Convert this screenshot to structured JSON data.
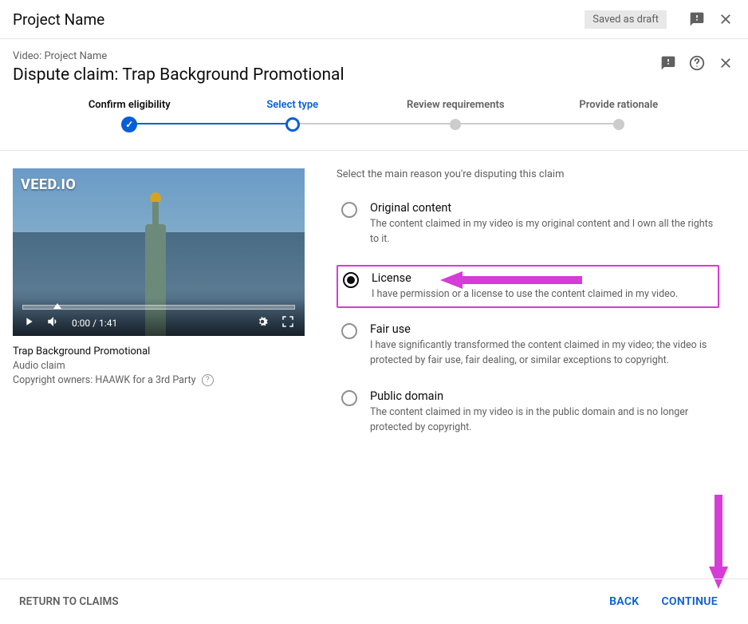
{
  "topbar": {
    "title": "Project Name",
    "saved_label": "Saved as draft"
  },
  "header": {
    "breadcrumb": "Video: Project Name",
    "title": "Dispute claim: Trap Background Promotional"
  },
  "stepper": [
    {
      "label": "Confirm eligibility",
      "state": "done"
    },
    {
      "label": "Select type",
      "state": "active"
    },
    {
      "label": "Review requirements",
      "state": "pending"
    },
    {
      "label": "Provide rationale",
      "state": "pending"
    }
  ],
  "video": {
    "watermark": "VEED.IO",
    "time": "0:00 / 1:41",
    "title": "Trap Background Promotional",
    "claim_type": "Audio claim",
    "owners": "Copyright owners: HAAWK for a 3rd Party"
  },
  "reasons": {
    "prompt": "Select the main reason you're disputing this claim",
    "options": [
      {
        "key": "original",
        "title": "Original content",
        "desc": "The content claimed in my video is my original content and I own all the rights to it.",
        "selected": false
      },
      {
        "key": "license",
        "title": "License",
        "desc": "I have permission or a license to use the content claimed in my video.",
        "selected": true
      },
      {
        "key": "fairuse",
        "title": "Fair use",
        "desc": "I have significantly transformed the content claimed in my video; the video is protected by fair use, fair dealing, or similar exceptions to copyright.",
        "selected": false
      },
      {
        "key": "public",
        "title": "Public domain",
        "desc": "The content claimed in my video is in the public domain and is no longer protected by copyright.",
        "selected": false
      }
    ]
  },
  "footer": {
    "return": "RETURN TO CLAIMS",
    "back": "BACK",
    "continue": "CONTINUE"
  },
  "annotation": {
    "color": "#d63cd6"
  }
}
